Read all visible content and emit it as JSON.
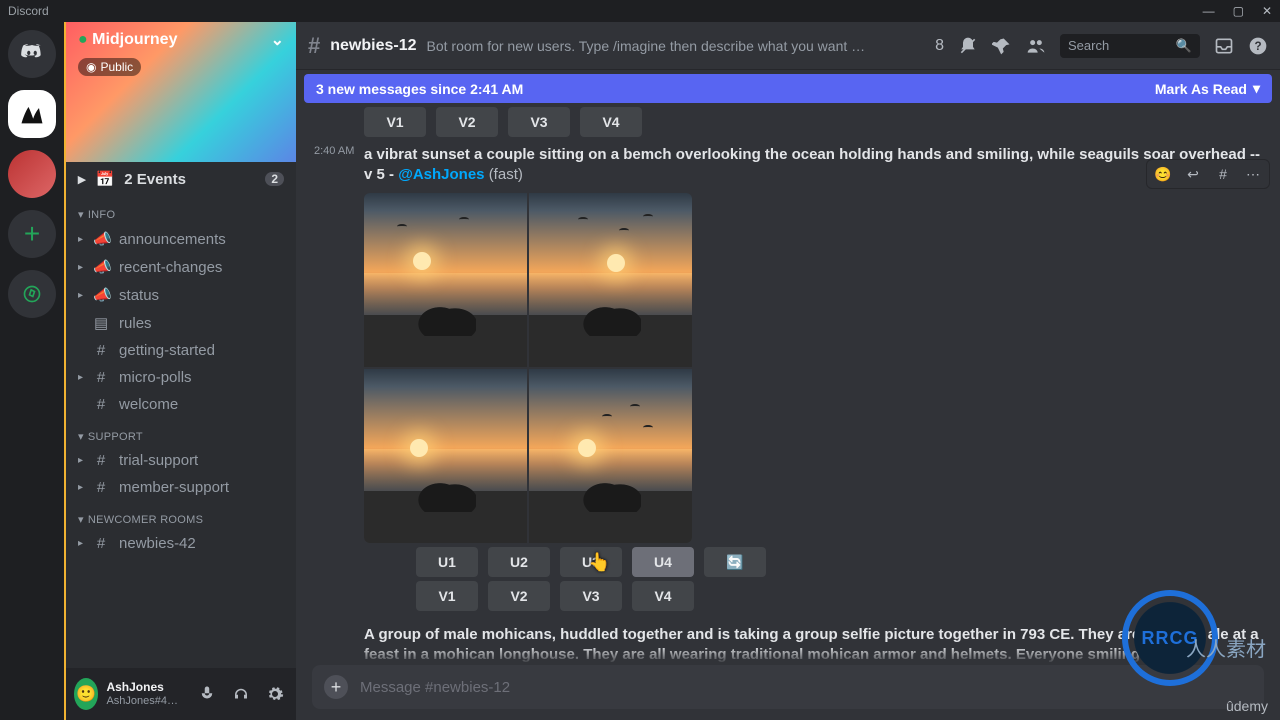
{
  "titlebar": {
    "app": "Discord"
  },
  "server": {
    "name": "Midjourney",
    "tag": "Public"
  },
  "events": {
    "label": "2 Events",
    "count": "2"
  },
  "categories": {
    "info": {
      "label": "INFO",
      "channels": [
        "announcements",
        "recent-changes",
        "status",
        "rules",
        "getting-started",
        "micro-polls",
        "welcome"
      ]
    },
    "support": {
      "label": "SUPPORT",
      "channels": [
        "trial-support",
        "member-support"
      ]
    },
    "newcomer": {
      "label": "NEWCOMER ROOMS",
      "channels": [
        "newbies-42"
      ]
    }
  },
  "user": {
    "name": "AshJones",
    "tag": "AshJones#4…"
  },
  "channel": {
    "name": "newbies-12",
    "topic": "Bot room for new users. Type /imagine then describe what you want to draw. …"
  },
  "toolbar": {
    "threads_count": "8",
    "search_placeholder": "Search"
  },
  "newbar": {
    "text": "3 new messages since 2:41 AM",
    "mark": "Mark As Read"
  },
  "prev_buttons": {
    "v": [
      "V1",
      "V2",
      "V3",
      "V4"
    ]
  },
  "message": {
    "time": "2:40 AM",
    "prompt": "a vibrat sunset a couple sitting on a bemch overlooking the ocean holding hands and smiling, while seaguils soar overhead --v 5 -",
    "mention": "@AshJones",
    "mode": "(fast)"
  },
  "buttons": {
    "u": [
      "U1",
      "U2",
      "U3",
      "U4"
    ],
    "v": [
      "V1",
      "V2",
      "V3",
      "V4"
    ]
  },
  "next_message": {
    "text": "A group of male mohicans, huddled together and is taking a group selfie picture together in 793 CE. They are drinking ale at a feast in a mohican longhouse. They are all wearing traditional mohican armor and helmets. Everyone smiling…"
  },
  "input": {
    "placeholder": "Message #newbies-12"
  },
  "watermarks": {
    "rrcg": "RRCG",
    "rrcg_sub": "人人素材",
    "udemy": "ûdemy"
  }
}
